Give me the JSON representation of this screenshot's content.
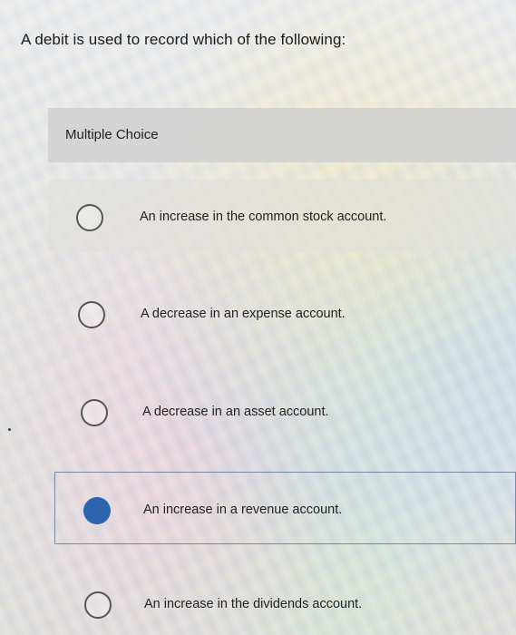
{
  "question": {
    "text": "A debit is used to record which of the following:"
  },
  "multiple_choice": {
    "header": "Multiple Choice",
    "options": [
      {
        "label": "An increase in the common stock account.",
        "selected": false
      },
      {
        "label": "A decrease in an expense account.",
        "selected": false
      },
      {
        "label": "A decrease in an asset account.",
        "selected": false
      },
      {
        "label": "An increase in a revenue account.",
        "selected": true
      },
      {
        "label": "An increase in the dividends account.",
        "selected": false
      }
    ]
  },
  "colors": {
    "selected_radio": "#2d64b0",
    "selected_border": "#7a8aa3"
  }
}
